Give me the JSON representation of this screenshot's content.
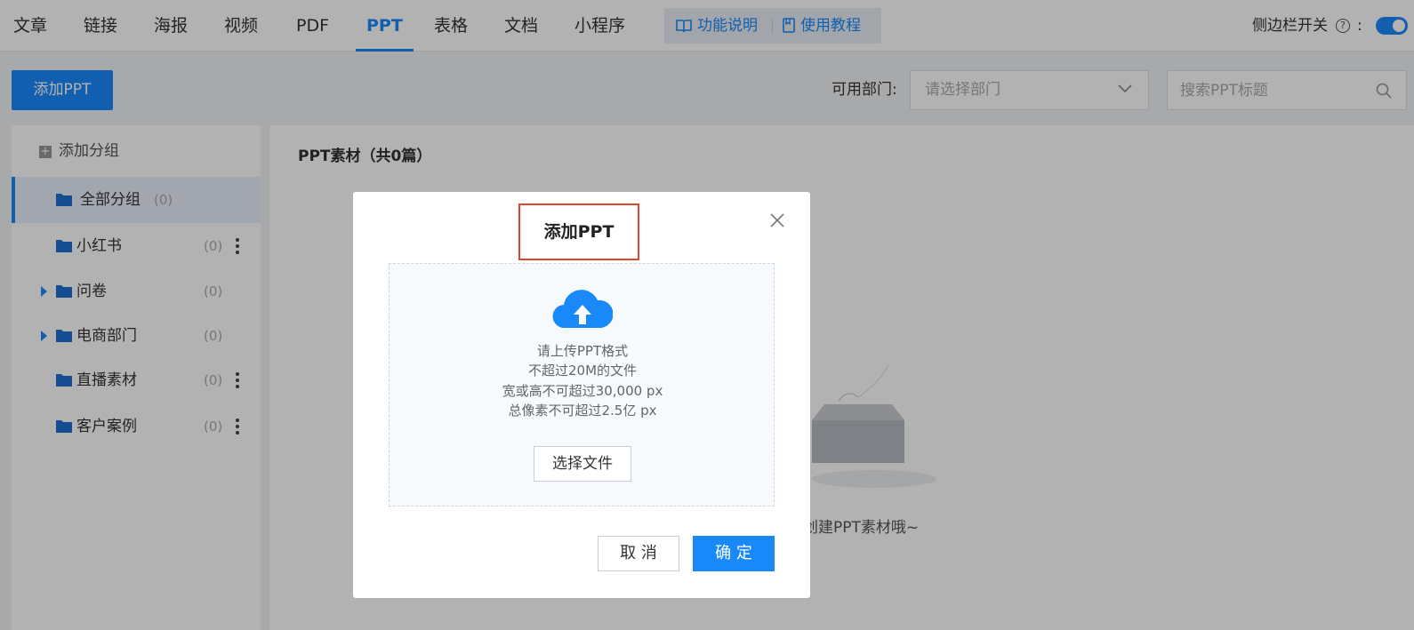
{
  "nav": {
    "tabs": [
      {
        "label": "文章"
      },
      {
        "label": "链接"
      },
      {
        "label": "海报"
      },
      {
        "label": "视频"
      },
      {
        "label": "PDF"
      },
      {
        "label": "PPT",
        "active": true
      },
      {
        "label": "表格"
      },
      {
        "label": "文档"
      },
      {
        "label": "小程序"
      }
    ],
    "help": {
      "features": "功能说明",
      "tutorial": "使用教程"
    },
    "sidebar_switch_label": "侧边栏开关",
    "help_q": "?",
    "colon": ":",
    "sidebar_switch_on": true
  },
  "toolbar": {
    "add_button": "添加PPT",
    "dept_label": "可用部门:",
    "dept_placeholder": "请选择部门",
    "search_placeholder": "搜索PPT标题"
  },
  "groups": {
    "add_label": "添加分组",
    "items": [
      {
        "label": "全部分组",
        "count": "(0)"
      },
      {
        "label": "小红书",
        "count": "(0)"
      },
      {
        "label": "问卷",
        "count": "(0)"
      },
      {
        "label": "电商部门",
        "count": "(0)"
      },
      {
        "label": "直播素材",
        "count": "(0)"
      },
      {
        "label": "客户案例",
        "count": "(0)"
      }
    ]
  },
  "content": {
    "title": "PPT素材（共0篇）",
    "empty_text": "创建PPT素材哦~"
  },
  "modal": {
    "title": "添加PPT",
    "tips": [
      "请上传PPT格式",
      "不超过20M的文件",
      "宽或高不可超过30,000 px",
      "总像素不可超过2.5亿 px"
    ],
    "choose_file": "选择文件",
    "cancel": "取 消",
    "ok": "确 定"
  },
  "colors": {
    "accent": "#1989fa",
    "highlight_border": "#e0452f"
  }
}
